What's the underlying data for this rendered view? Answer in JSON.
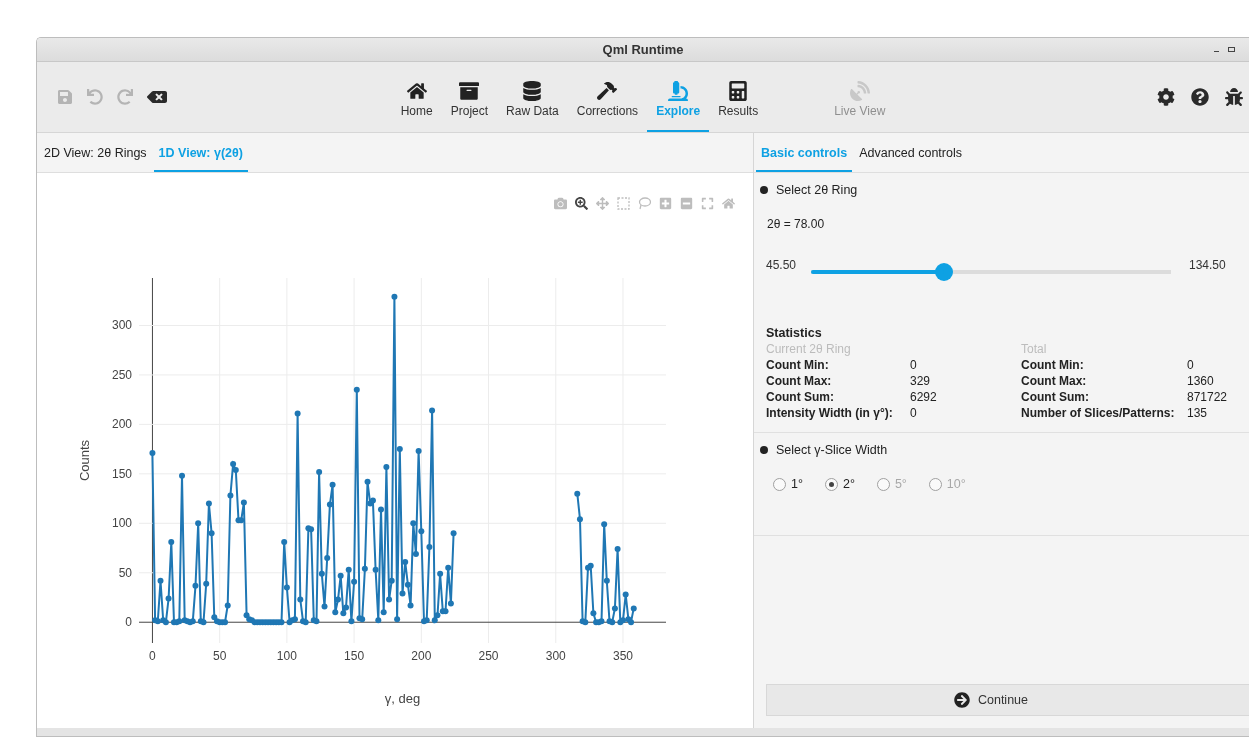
{
  "window": {
    "title": "Qml Runtime"
  },
  "toolbar": {
    "edit_tools": [
      {
        "disabled": true
      },
      {
        "disabled": true
      },
      {
        "disabled": true
      },
      {
        "disabled": false
      }
    ],
    "nav": [
      {
        "label": "Home",
        "selected": false,
        "disabled": false
      },
      {
        "label": "Project",
        "selected": false,
        "disabled": false
      },
      {
        "label": "Raw Data",
        "selected": false,
        "disabled": false
      },
      {
        "label": "Corrections",
        "selected": false,
        "disabled": false
      },
      {
        "label": "Explore",
        "selected": true,
        "disabled": false
      },
      {
        "label": "Results",
        "selected": false,
        "disabled": false
      }
    ],
    "live_view": {
      "label": "Live View",
      "selected": false,
      "disabled": true
    }
  },
  "view_tabs": [
    {
      "label": "2D View: 2θ Rings",
      "selected": false
    },
    {
      "label": "1D View: γ(2θ)",
      "selected": true
    }
  ],
  "modebar": [
    {
      "active": false
    },
    {
      "active": true
    },
    {
      "active": false
    },
    {
      "active": false
    },
    {
      "active": false
    },
    {
      "active": false
    },
    {
      "active": false
    },
    {
      "active": false
    },
    {
      "active": false
    }
  ],
  "chart_data": {
    "type": "line",
    "grid": true,
    "xlabel": "γ, deg",
    "ylabel": "Counts",
    "xlim": [
      -10,
      382
    ],
    "ylim": [
      -21,
      348
    ],
    "xticks": [
      0,
      50,
      100,
      150,
      200,
      250,
      300,
      350
    ],
    "yticks": [
      0,
      50,
      100,
      150,
      200,
      250,
      300
    ],
    "x": [
      0,
      2,
      4,
      6,
      8,
      10,
      12,
      14,
      16,
      18,
      20,
      22,
      24,
      26,
      28,
      30,
      32,
      34,
      36,
      38,
      40,
      42,
      44,
      46,
      48,
      50,
      52,
      54,
      56,
      58,
      60,
      62,
      64,
      66,
      68,
      70,
      72,
      74,
      76,
      78,
      80,
      82,
      84,
      86,
      88,
      90,
      92,
      94,
      96,
      98,
      100,
      102,
      104,
      106,
      108,
      110,
      112,
      114,
      116,
      118,
      120,
      122,
      124,
      126,
      128,
      130,
      132,
      134,
      136,
      138,
      140,
      142,
      144,
      146,
      148,
      150,
      152,
      154,
      156,
      158,
      160,
      162,
      164,
      166,
      168,
      170,
      172,
      174,
      176,
      178,
      180,
      182,
      184,
      186,
      188,
      190,
      192,
      194,
      196,
      198,
      200,
      202,
      204,
      206,
      208,
      210,
      212,
      214,
      216,
      218,
      220,
      222,
      224,
      226,
      228,
      230,
      232,
      234,
      236,
      238,
      240,
      242,
      244,
      246,
      248,
      250,
      252,
      254,
      256,
      258,
      260,
      262,
      264,
      266,
      268,
      270,
      272,
      274,
      276,
      278,
      280,
      282,
      284,
      286,
      288,
      290,
      292,
      294,
      296,
      298,
      300,
      302,
      304,
      306,
      308,
      310,
      312,
      314,
      316,
      318,
      320,
      322,
      324,
      326,
      328,
      330,
      332,
      334,
      336,
      338,
      340,
      342,
      344,
      346,
      348,
      350,
      352,
      354,
      356,
      358
    ],
    "series": [
      {
        "color": "#1f77b4",
        "marker": true,
        "values": [
          171,
          2,
          1,
          42,
          2,
          0,
          24,
          81,
          0,
          0,
          1,
          148,
          2,
          1,
          0,
          1,
          37,
          100,
          1,
          0,
          39,
          120,
          90,
          5,
          1,
          0,
          0,
          0,
          17,
          128,
          160,
          154,
          103,
          103,
          121,
          7,
          3,
          2,
          0,
          0,
          0,
          0,
          0,
          0,
          0,
          0,
          0,
          0,
          0,
          81,
          35,
          0,
          2,
          3,
          211,
          23,
          1,
          0,
          95,
          94,
          2,
          1,
          152,
          49,
          16,
          65,
          119,
          139,
          10,
          23,
          47,
          9,
          15,
          53,
          1,
          41,
          235,
          4,
          3,
          54,
          142,
          120,
          123,
          53,
          2,
          114,
          10,
          157,
          23,
          42,
          329,
          3,
          175,
          29,
          61,
          38,
          17,
          100,
          69,
          173,
          92,
          1,
          2,
          76,
          214,
          2,
          7,
          49,
          11,
          11,
          55,
          19,
          90,
          null,
          null,
          null,
          null,
          null,
          null,
          null,
          null,
          null,
          null,
          null,
          null,
          null,
          null,
          null,
          null,
          null,
          null,
          null,
          null,
          null,
          null,
          null,
          null,
          null,
          null,
          null,
          null,
          null,
          null,
          null,
          null,
          null,
          null,
          null,
          null,
          null,
          null,
          null,
          null,
          null,
          null,
          null,
          null,
          null,
          130,
          104,
          1,
          0,
          55,
          57,
          9,
          0,
          0,
          1,
          99,
          42,
          1,
          0,
          14,
          74,
          0,
          2,
          28,
          3,
          0,
          14
        ]
      }
    ]
  },
  "control_tabs": [
    {
      "label": "Basic controls",
      "selected": true
    },
    {
      "label": "Advanced controls",
      "selected": false
    }
  ],
  "ring_section": {
    "title": "Select 2θ Ring",
    "value_label": "2θ = 78.00",
    "slider": {
      "min_label": "45.50",
      "max_label": "134.50",
      "level": 0.37
    }
  },
  "statistics": {
    "title": "Statistics",
    "columns": [
      {
        "heading": "Current 2θ Ring",
        "rows": [
          {
            "label": "Count Min:",
            "value": "0"
          },
          {
            "label": "Count Max:",
            "value": "329"
          },
          {
            "label": "Count Sum:",
            "value": "6292"
          },
          {
            "label": "Intensity Width (in γ°):",
            "value": "0"
          }
        ]
      },
      {
        "heading": "Total",
        "rows": [
          {
            "label": "Count Min:",
            "value": "0"
          },
          {
            "label": "Count Max:",
            "value": "1360"
          },
          {
            "label": "Count Sum:",
            "value": "871722"
          },
          {
            "label": "Number of Slices/Patterns:",
            "value": "135"
          }
        ]
      }
    ]
  },
  "slice_section": {
    "title": "Select γ-Slice Width",
    "options": [
      {
        "label": "1°",
        "selected": false,
        "disabled": false
      },
      {
        "label": "2°",
        "selected": true,
        "disabled": false
      },
      {
        "label": "5°",
        "selected": false,
        "disabled": true
      },
      {
        "label": "10°",
        "selected": false,
        "disabled": true
      }
    ]
  },
  "continue_button": {
    "label": "Continue"
  }
}
